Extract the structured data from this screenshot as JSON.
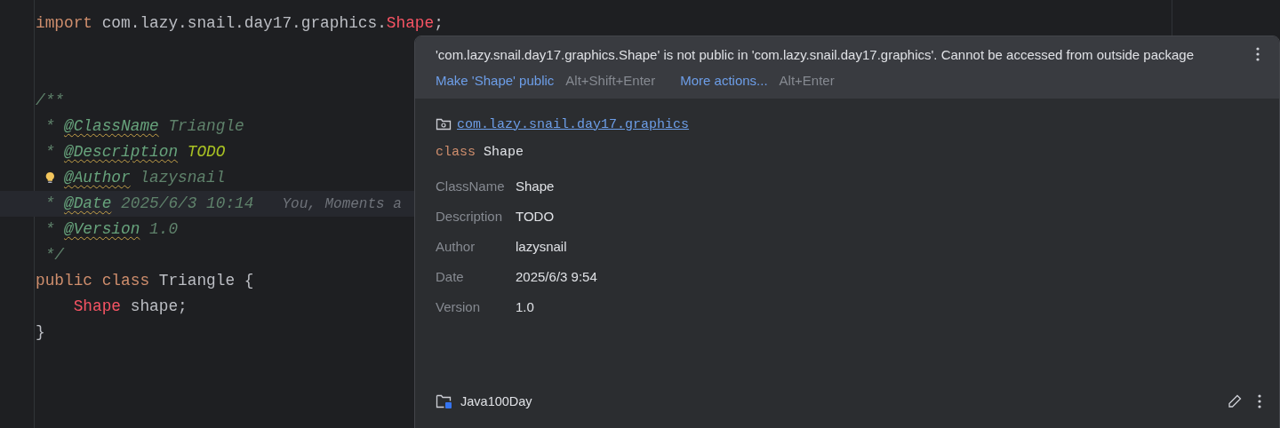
{
  "editor": {
    "lines": [
      {
        "current": false,
        "tokens": [
          {
            "kind": "keyword",
            "text": "import"
          },
          {
            "kind": "plain",
            "text": " com.lazy.snail.day17.graphics."
          },
          {
            "kind": "error",
            "text": "Shape"
          },
          {
            "kind": "plain",
            "text": ";"
          }
        ]
      },
      {
        "current": false
      },
      {
        "current": false
      },
      {
        "current": false,
        "tokens": [
          {
            "kind": "comment",
            "text": "/**"
          }
        ]
      },
      {
        "current": false,
        "tokens": [
          {
            "kind": "comment",
            "text": " * "
          },
          {
            "kind": "doctag",
            "text": "@ClassName"
          },
          {
            "kind": "comment",
            "text": " Triangle"
          }
        ]
      },
      {
        "current": false,
        "tokens": [
          {
            "kind": "comment",
            "text": " * "
          },
          {
            "kind": "doctag",
            "text": "@Description"
          },
          {
            "kind": "todo",
            "text": " TODO"
          }
        ]
      },
      {
        "current": false,
        "tokens": [
          {
            "kind": "bulb"
          },
          {
            "kind": "doctag",
            "text": "@Author"
          },
          {
            "kind": "comment",
            "text": " lazysnail"
          }
        ]
      },
      {
        "current": true,
        "tokens": [
          {
            "kind": "comment",
            "text": " * "
          },
          {
            "kind": "doctag",
            "text": "@Date"
          },
          {
            "kind": "comment",
            "text": " 2025/6/3 10:14"
          },
          {
            "kind": "hint",
            "text": "You, Moments a"
          }
        ]
      },
      {
        "current": false,
        "tokens": [
          {
            "kind": "comment",
            "text": " * "
          },
          {
            "kind": "doctag",
            "text": "@Version"
          },
          {
            "kind": "comment",
            "text": " 1.0"
          }
        ]
      },
      {
        "current": false,
        "tokens": [
          {
            "kind": "comment",
            "text": " */"
          }
        ]
      },
      {
        "current": false,
        "tokens": [
          {
            "kind": "keyword",
            "text": "public class"
          },
          {
            "kind": "plain",
            "text": " Triangle {"
          }
        ]
      },
      {
        "current": false,
        "tokens": [
          {
            "kind": "error",
            "text": "    Shape"
          },
          {
            "kind": "plain",
            "text": " shape;"
          }
        ]
      },
      {
        "current": false,
        "tokens": [
          {
            "kind": "plain",
            "text": "}"
          }
        ]
      }
    ]
  },
  "popup": {
    "message": "'com.lazy.snail.day17.graphics.Shape' is not public in 'com.lazy.snail.day17.graphics'. Cannot be accessed from outside package",
    "actions": [
      {
        "label": "Make 'Shape' public",
        "shortcut": "Alt+Shift+Enter"
      },
      {
        "label": "More actions...",
        "shortcut": "Alt+Enter"
      }
    ],
    "package": "com.lazy.snail.day17.graphics",
    "declaration": {
      "keyword": "class",
      "name": "Shape"
    },
    "fields": [
      {
        "label": "ClassName",
        "value": "Shape"
      },
      {
        "label": "Description",
        "value": "TODO"
      },
      {
        "label": "Author",
        "value": "lazysnail"
      },
      {
        "label": "Date",
        "value": "2025/6/3 9:54"
      },
      {
        "label": "Version",
        "value": "1.0"
      }
    ],
    "module": "Java100Day"
  }
}
